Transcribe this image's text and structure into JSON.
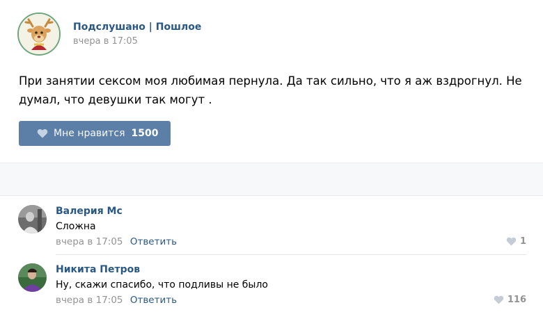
{
  "post": {
    "author": "Подслушано | Пошлое",
    "time": "вчера в 17:05",
    "text": "При занятии сексом моя любимая пернула. Да так сильно, что я аж вздрогнул. Не думал, что девушки так могут .",
    "like_label": "Мне нравится",
    "like_count": "1500"
  },
  "comments": [
    {
      "name": "Валерия Мс",
      "text": "Сложна",
      "time": "вчера в 17:05",
      "reply": "Ответить",
      "likes": "1"
    },
    {
      "name": "Никита Петров",
      "text": "Ну, скажи спасибо, что подливы не было",
      "time": "вчера в 17:05",
      "reply": "Ответить",
      "likes": "116"
    }
  ],
  "icons": {
    "like": "heart-icon"
  },
  "colors": {
    "link": "#2a5885",
    "button": "#5b7fa6",
    "muted": "#939393"
  }
}
